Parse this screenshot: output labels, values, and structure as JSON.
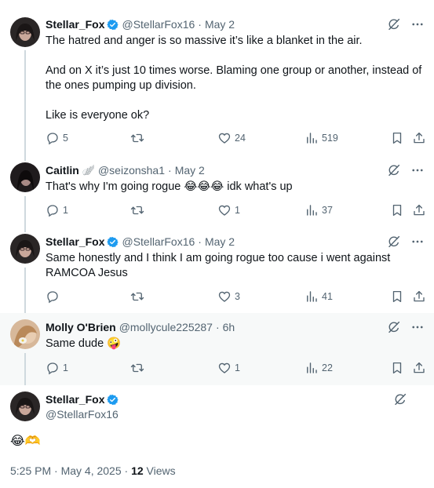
{
  "tweets": [
    {
      "name": "Stellar_Fox",
      "handle": "@StellarFox16",
      "separator": "·",
      "time": "May 2",
      "text": "The hatred and anger is so massive it’s like a blanket in the air.\n\nAnd on X it’s just 10 times worse. Blaming one group or another, instead of the ones pumping up division.\n\nLike is everyone ok?",
      "replies": "5",
      "reposts": "",
      "likes": "24",
      "views": "519"
    },
    {
      "name": "Caitlin",
      "name_emoji": "🪽",
      "handle": "@seizonsha1",
      "separator": "·",
      "time": "May 2",
      "text": "That's why I'm going rogue 😂😂😂 idk what's up",
      "replies": "1",
      "reposts": "",
      "likes": "1",
      "views": "37"
    },
    {
      "name": "Stellar_Fox",
      "handle": "@StellarFox16",
      "separator": "·",
      "time": "May 2",
      "text": "Same honestly and I think I am going rogue too cause i went against RAMCOA Jesus",
      "replies": "",
      "reposts": "",
      "likes": "3",
      "views": "41"
    },
    {
      "name": "Molly O'Brien",
      "handle": "@mollycule225287",
      "separator": "·",
      "time": "6h",
      "text": "Same dude 🤪",
      "replies": "1",
      "reposts": "",
      "likes": "1",
      "views": "22"
    }
  ],
  "main": {
    "name": "Stellar_Fox",
    "handle": "@StellarFox16",
    "text": "😂🫶",
    "time": "5:25 PM · May 4, 2025 · ",
    "views_count": "12",
    "views_label": " Views"
  },
  "colors": {
    "verified": "#1d9bf0",
    "muted": "#536471",
    "line": "#cfd9de",
    "highlight_bg": "#f7f9f9"
  },
  "icons": [
    "grok-icon",
    "more-icon",
    "reply-icon",
    "repost-icon",
    "like-icon",
    "views-icon",
    "bookmark-icon",
    "share-icon",
    "verified-badge-icon"
  ]
}
